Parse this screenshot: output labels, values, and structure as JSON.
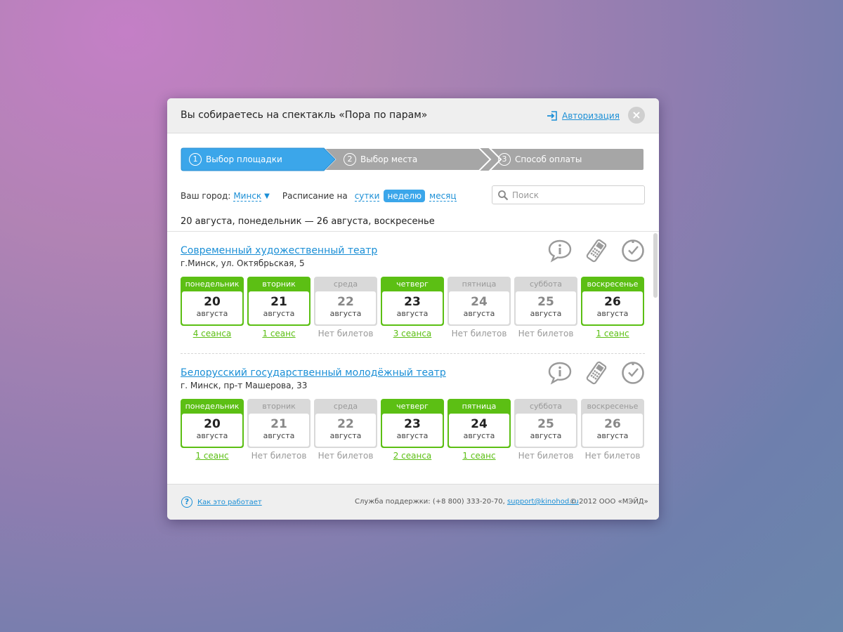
{
  "modal": {
    "title": "Вы собираетесь на спектакль «Пора по парам»",
    "auth_label": "Авторизация",
    "close_label": "×"
  },
  "steps": [
    {
      "num": "1",
      "label": "Выбор площадки",
      "active": true
    },
    {
      "num": "2",
      "label": "Выбор места",
      "active": false
    },
    {
      "num": "3",
      "label": "Способ оплаты",
      "active": false
    }
  ],
  "filters": {
    "city_label": "Ваш город:",
    "city_value": "Минск",
    "schedule_label": "Расписание на",
    "periods": [
      "сутки",
      "неделю",
      "месяц"
    ],
    "active_period": "неделю",
    "search_placeholder": "Поиск"
  },
  "date_range": "20 августа, понедельник — 26 августа, воскресенье",
  "venues": [
    {
      "name": "Современный художественный театр",
      "address": "г.Минск, ул. Октябрьская, 5",
      "days": [
        {
          "name": "понедельник",
          "num": "20",
          "month": "августа",
          "status": "4 сеанса",
          "available": true
        },
        {
          "name": "вторник",
          "num": "21",
          "month": "августа",
          "status": "1 сеанс",
          "available": true
        },
        {
          "name": "среда",
          "num": "22",
          "month": "августа",
          "status": "Нет билетов",
          "available": false
        },
        {
          "name": "четверг",
          "num": "23",
          "month": "августа",
          "status": "3 сеанса",
          "available": true
        },
        {
          "name": "пятница",
          "num": "24",
          "month": "августа",
          "status": "Нет билетов",
          "available": false
        },
        {
          "name": "суббота",
          "num": "25",
          "month": "августа",
          "status": "Нет билетов",
          "available": false
        },
        {
          "name": "воскресенье",
          "num": "26",
          "month": "августа",
          "status": "1 сеанс",
          "available": true
        }
      ]
    },
    {
      "name": "Белорусский государственный молодёжный театр",
      "address": "г. Минск, пр-т Машерова, 33",
      "days": [
        {
          "name": "понедельник",
          "num": "20",
          "month": "августа",
          "status": "1 сеанс",
          "available": true
        },
        {
          "name": "вторник",
          "num": "21",
          "month": "августа",
          "status": "Нет билетов",
          "available": false
        },
        {
          "name": "среда",
          "num": "22",
          "month": "августа",
          "status": "Нет билетов",
          "available": false
        },
        {
          "name": "четверг",
          "num": "23",
          "month": "августа",
          "status": "2 сеанса",
          "available": true
        },
        {
          "name": "пятница",
          "num": "24",
          "month": "августа",
          "status": "1 сеанс",
          "available": true
        },
        {
          "name": "суббота",
          "num": "25",
          "month": "августа",
          "status": "Нет билетов",
          "available": false
        },
        {
          "name": "воскресенье",
          "num": "26",
          "month": "августа",
          "status": "Нет билетов",
          "available": false
        }
      ]
    }
  ],
  "footer": {
    "help_label": "Как это работает",
    "support_text": "Служба поддержки: (+8 800) 333-20-70,",
    "support_email": "support@kinohod.ru",
    "copyright": "© 2012  ООО «МЭЙД»"
  },
  "colors": {
    "accent_blue": "#3ba6ea",
    "link_blue": "#1b8fd6",
    "available_green": "#5cbf14",
    "inactive_gray": "#a6a6a6"
  },
  "icons": [
    "sign-in-icon",
    "close-icon",
    "search-icon",
    "info-icon",
    "phone-icon",
    "clock-icon",
    "help-icon"
  ]
}
